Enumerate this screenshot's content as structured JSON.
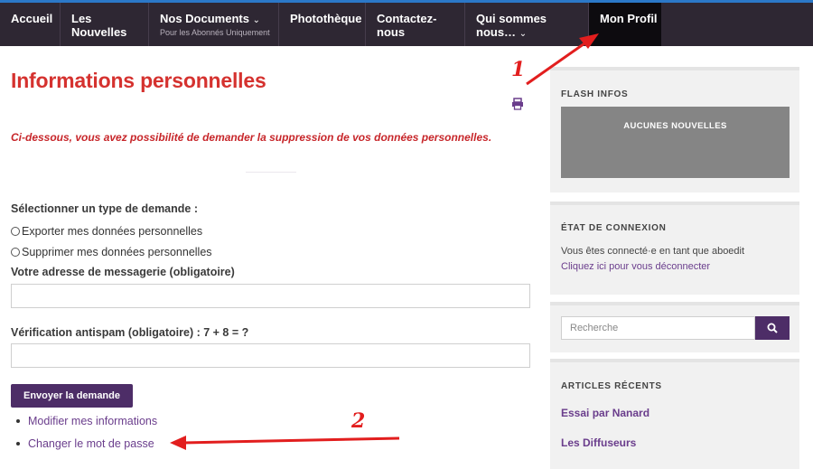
{
  "nav": {
    "items": [
      {
        "label": "Accueil"
      },
      {
        "label": "Les Nouvelles"
      },
      {
        "label": "Nos Documents",
        "sub": "Pour les Abonnés Uniquement"
      },
      {
        "label": "Photothèque"
      },
      {
        "label": "Contactez-nous"
      },
      {
        "label": "Qui sommes nous…"
      },
      {
        "label": "Mon Profil"
      }
    ]
  },
  "main": {
    "title": "Informations personnelles",
    "intro": "Ci-dessous, vous avez possibilité de demander la suppression de vos données personnelles.",
    "request_type_label": "Sélectionner un type de demande :",
    "option_export": "Exporter mes données personnelles",
    "option_delete": "Supprimer mes données personnelles",
    "email_label": "Votre adresse de messagerie (obligatoire)",
    "email_value": "",
    "antispam_label": "Vérification antispam (obligatoire) : 7 + 8 = ?",
    "antispam_value": "",
    "submit_label": "Envoyer la demande",
    "links": [
      "Modifier mes informations",
      "Changer le mot de passe"
    ]
  },
  "sidebar": {
    "flash": {
      "title": "FLASH INFOS",
      "box_text": "AUCUNES NOUVELLES"
    },
    "connexion": {
      "title": "ÉTAT DE CONNEXION",
      "status": "Vous êtes connecté·e en tant que aboedit",
      "logout": "Cliquez ici pour vous déconnecter"
    },
    "search": {
      "placeholder": "Recherche"
    },
    "recent": {
      "title": "ARTICLES RÉCENTS",
      "items": [
        "Essai par Nanard",
        "Les Diffuseurs"
      ]
    }
  },
  "annotations": {
    "marker_1": "1",
    "marker_2": "2",
    "color": "#e21e1e"
  },
  "colors": {
    "nav_bg": "#2e2733",
    "accent": "#4d2d67",
    "title_red": "#d5322f",
    "link": "#6a3d8c"
  }
}
